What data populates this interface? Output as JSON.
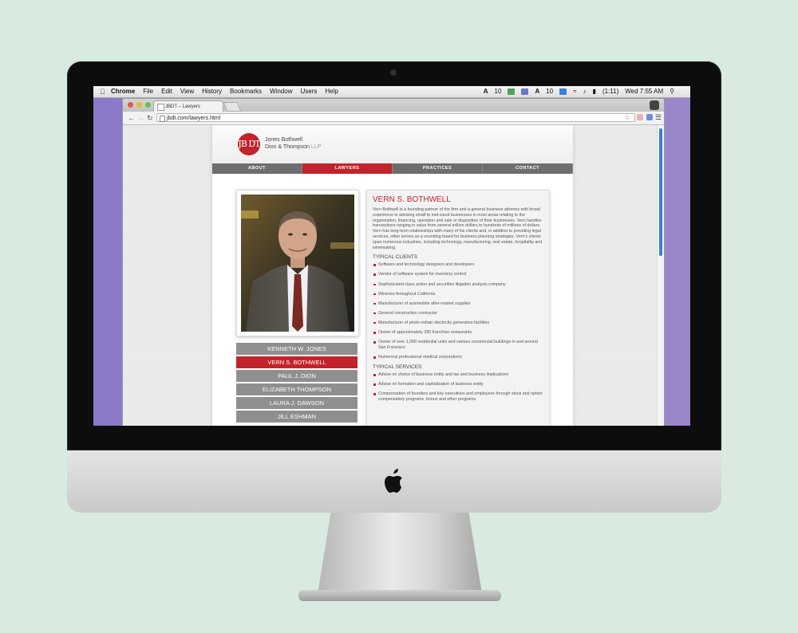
{
  "menubar": {
    "app_menus": [
      "Chrome",
      "File",
      "Edit",
      "View",
      "History",
      "Bookmarks",
      "Window",
      "Users",
      "Help"
    ],
    "status_numbers": [
      "10",
      "10"
    ],
    "battery": "(1:11)",
    "clock": "Wed 7:55 AM"
  },
  "browser": {
    "tab_title": "JBDT – Lawyers",
    "url": "jbdt.com/lawyers.html"
  },
  "site": {
    "logo_mark": "JB DT",
    "firm_line1": "Jones Bothwell",
    "firm_line2": "Dion & Thompson",
    "firm_suffix": "LLP",
    "nav": [
      {
        "label": "ABOUT",
        "active": false
      },
      {
        "label": "LAWYERS",
        "active": true
      },
      {
        "label": "PRACTICES",
        "active": false
      },
      {
        "label": "CONTACT",
        "active": false
      }
    ],
    "lawyers": [
      {
        "name": "KENNETH W. JONES",
        "active": false
      },
      {
        "name": "VERN S. BOTHWELL",
        "active": true
      },
      {
        "name": "PAUL J. DION",
        "active": false
      },
      {
        "name": "ELIZABETH THOMPSON",
        "active": false
      },
      {
        "name": "LAURA J. DAWSON",
        "active": false
      },
      {
        "name": "JILL ESHMAN",
        "active": false
      }
    ],
    "bio": {
      "name": "VERN S. BOTHWELL",
      "paragraph": "Vern Bothwell is a founding partner of the firm and a general business attorney with broad experience in advising small to mid-sized businesses in most areas relating to the organization, financing, operation and sale or disposition of their businesses. Vern handles transactions ranging in value from several million dollars to hundreds of millions of dollars. Vern has long-term relationships with many of his clients and, in addition to providing legal services, often serves as a sounding board for business planning strategies. Vern's clients span numerous industries, including technology, manufacturing, real estate, hospitality and winemaking.",
      "clients_title": "TYPICAL CLIENTS",
      "clients": [
        "Software and technology designers and developers",
        "Vendor of software system for inventory control",
        "Sophisticated class action and securities litigation analysis company",
        "Wineries throughout California",
        "Manufacturer of automobile after-market supplies",
        "General construction contractor",
        "Manufacturer of photo-voltaic electricity generation facilities",
        "Owner of approximately 250 franchise restaurants",
        "Owner of over 1,000 residential units and various commercial buildings in and around San Francisco",
        "Numerous professional medical corporations"
      ],
      "services_title": "TYPICAL SERVICES",
      "services": [
        "Advise on choice of business entity and tax and business implications",
        "Advise on formation and capitalization of business entity",
        "Compensation of founders and key executives and employees through stock and option compensatory programs, bonus and other programs"
      ]
    }
  },
  "colors": {
    "accent_red": "#c3232b",
    "nav_gray": "#6e6e6e",
    "list_gray": "#8f8f8f",
    "desktop_purple": "#9a86c8",
    "wall": "#d9ebe1"
  }
}
